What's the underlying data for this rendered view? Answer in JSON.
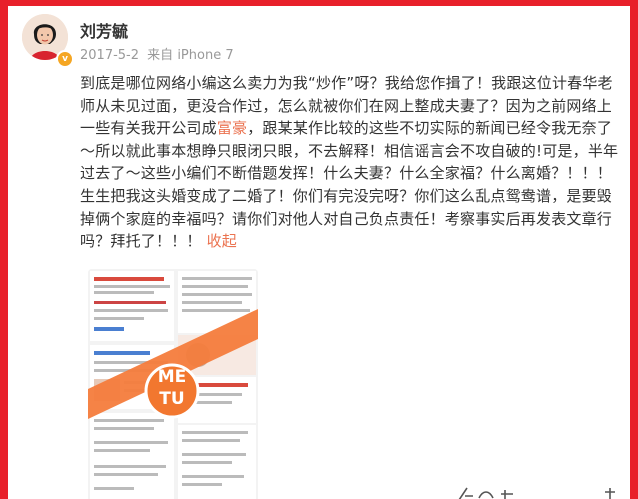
{
  "user": {
    "name": "刘芳毓",
    "verified_badge": "v-icon"
  },
  "meta": {
    "date": "2017-5-2",
    "source_prefix": "来自",
    "device": "iPhone 7"
  },
  "post": {
    "part1": "到底是哪位网络小编这么卖力为我“炒作”呀？我给您作揖了！我跟这位计春华老师从未见过面，更没合作过，怎么就被你们在网上整成夫妻了？因为之前网络上一些有关我开公司成",
    "highlight": "富豪",
    "part2": "，跟某某作比较的这些不切实际的新闻已经令我无奈了～所以就此事本想睁只眼闭只眼，不去解释！相信谣言会不攻自破的!可是，半年过去了～这些小编们不断借题发挥！什么夫妻？什么全家福？什么离婚？！！！生生把我这头婚变成了二婚了！你们有完没完呀？你们这么乱点鸳鸯谱，是要毁掉俩个家庭的幸福吗？请你们对他人对自己负点责任！考察事实后再发表文章行吗？拜托了！！！",
    "collapse_label": "收起"
  },
  "thumbnail": {
    "mark_letters": [
      "ME",
      "TU"
    ]
  },
  "colors": {
    "frame": "#e8202a",
    "link": "#eb7350",
    "text": "#333333",
    "meta": "#999999"
  }
}
